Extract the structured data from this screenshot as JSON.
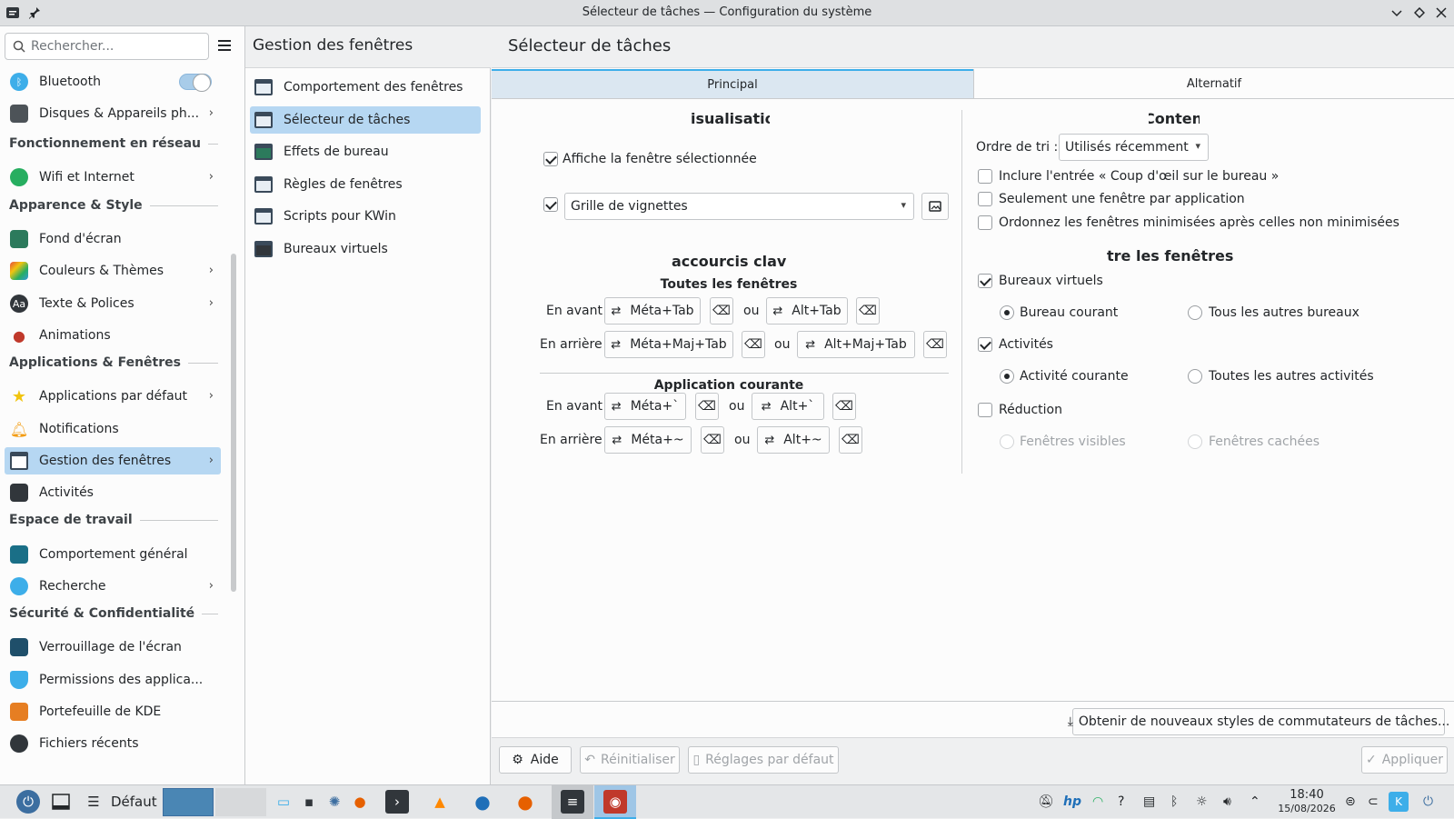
{
  "window": {
    "title": "Sélecteur de tâches — Configuration du système"
  },
  "sidebar": {
    "search_placeholder": "Rechercher...",
    "items": [
      {
        "label": "Bluetooth"
      },
      {
        "label": "Disques & Appareils ph..."
      },
      {
        "header": "Fonctionnement en réseau"
      },
      {
        "label": "Wifi et Internet"
      },
      {
        "header": "Apparence & Style"
      },
      {
        "label": "Fond d'écran"
      },
      {
        "label": "Couleurs & Thèmes"
      },
      {
        "label": "Texte & Polices"
      },
      {
        "label": "Animations"
      },
      {
        "header": "Applications & Fenêtres"
      },
      {
        "label": "Applications par défaut"
      },
      {
        "label": "Notifications"
      },
      {
        "label": "Gestion des fenêtres"
      },
      {
        "label": "Activités"
      },
      {
        "header": "Espace de travail"
      },
      {
        "label": "Comportement général"
      },
      {
        "label": "Recherche"
      },
      {
        "header": "Sécurité & Confidentialité"
      },
      {
        "label": "Verrouillage de l'écran"
      },
      {
        "label": "Permissions des applica..."
      },
      {
        "label": "Portefeuille de KDE"
      },
      {
        "label": "Fichiers récents"
      }
    ]
  },
  "middle": {
    "title": "Gestion des fenêtres",
    "items": [
      "Comportement des fenêtres",
      "Sélecteur de tâches",
      "Effets de bureau",
      "Règles de fenêtres",
      "Scripts pour KWin",
      "Bureaux virtuels"
    ]
  },
  "main": {
    "title": "Sélecteur de tâches",
    "tabs": [
      "Principal",
      "Alternatif"
    ],
    "visualisation": {
      "header": "isualisatio",
      "show_selected": "Affiche la fenêtre sélectionnée",
      "style_value": "Grille de vignettes"
    },
    "shortcuts": {
      "header": "accourcis clavi",
      "all_windows": "Toutes les fenêtres",
      "current_app": "Application courante",
      "forward": "En avant",
      "backward": "En arrière",
      "or": "ou",
      "all_fwd_1": "Méta+Tab",
      "all_fwd_2": "Alt+Tab",
      "all_bwd_1": "Méta+Maj+Tab",
      "all_bwd_2": "Alt+Maj+Tab",
      "app_fwd_1": "Méta+`",
      "app_fwd_2": "Alt+`",
      "app_bwd_1": "Méta+~",
      "app_bwd_2": "Alt+~"
    },
    "content": {
      "header": "Contenu",
      "sort_label": "Ordre de tri :",
      "sort_value": "Utilisés récemment",
      "opt1": "Inclure l'entrée « Coup d'œil sur le bureau »",
      "opt2": "Seulement une fenêtre par application",
      "opt3": "Ordonnez les fenêtres minimisées après celles non minimisées"
    },
    "filter": {
      "header": "tre les fenêtres p",
      "virtual_desktops": "Bureaux virtuels",
      "current_desktop": "Bureau courant",
      "other_desktops": "Tous les autres bureaux",
      "activities": "Activités",
      "current_activity": "Activité courante",
      "other_activities": "Toutes les autres activités",
      "minimization": "Réduction",
      "visible_windows": "Fenêtres visibles",
      "hidden_windows": "Fenêtres cachées"
    },
    "get_new": "Obtenir de nouveaux styles de commutateurs de tâches...",
    "buttons": {
      "help": "Aide",
      "reset": "Réinitialiser",
      "defaults": "Réglages par défaut",
      "apply": "Appliquer"
    }
  },
  "taskbar": {
    "activity": "Défaut",
    "time": "18:40",
    "date": "15/08/2026"
  },
  "colors": {
    "accent": "#3daee9",
    "selection": "#b6d7f2"
  }
}
